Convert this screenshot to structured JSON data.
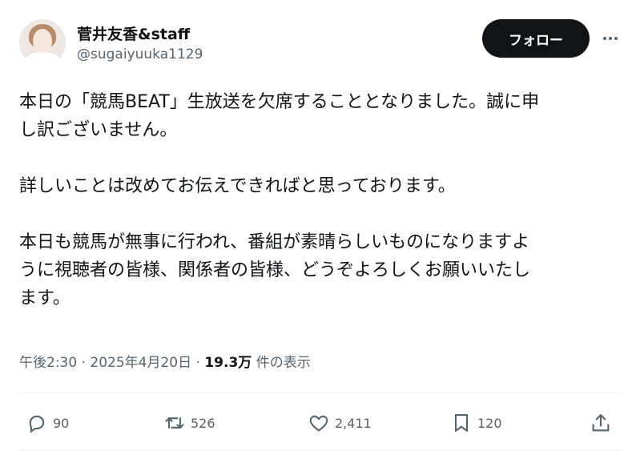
{
  "header": {
    "display_name": "菅井友香&staff",
    "handle": "@sugaiyuuka1129",
    "follow_label": "フォロー"
  },
  "tweet": {
    "lines_p1": [
      "本日の「競馬BEAT」生放送を欠席することとなりました。誠に申",
      "し訳ございません。"
    ],
    "lines_p2": [
      "詳しいことは改めてお伝えできればと思っております。"
    ],
    "lines_p3": [
      "本日も競馬が無事に行われ、番組が素晴らしいものになりますよ",
      "うに視聴者の皆様、関係者の皆様、どうぞよろしくお願いいたし",
      "ます。"
    ]
  },
  "meta": {
    "time": "午後2:30",
    "sep": " · ",
    "date": "2025年4月20日",
    "views": "19.3万",
    "views_label": " 件の表示"
  },
  "actions": {
    "replies": "90",
    "retweets": "526",
    "likes": "2,411",
    "bookmarks": "120"
  },
  "icons": {
    "reply": "reply-icon",
    "retweet": "retweet-icon",
    "like": "heart-icon",
    "bookmark": "bookmark-icon",
    "share": "share-icon",
    "more": "more-icon"
  },
  "colors": {
    "text": "#0f1419",
    "secondary": "#536471",
    "follow_bg": "#0f1419"
  }
}
